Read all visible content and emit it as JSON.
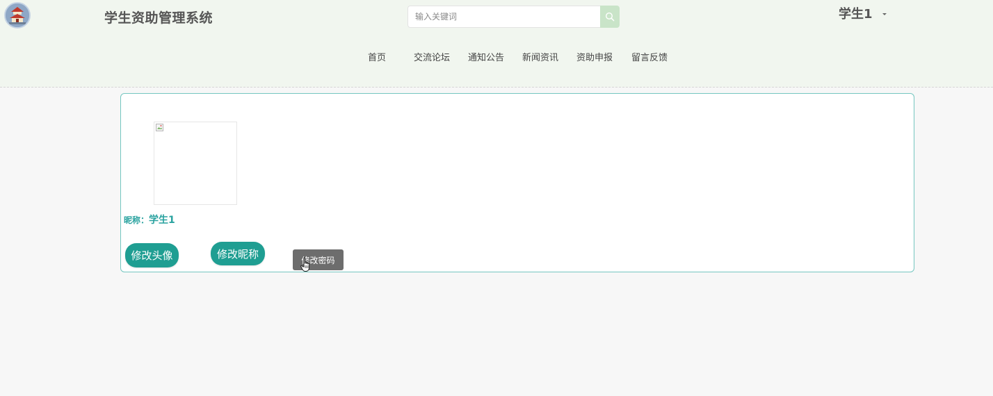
{
  "header": {
    "site_title": "学生资助管理系统",
    "logo_icon": "building-logo-icon",
    "search": {
      "placeholder": "输入关键词",
      "value": "",
      "button_icon": "search-icon"
    },
    "user": {
      "name": "学生1",
      "dropdown_icon": "caret-down-icon"
    }
  },
  "nav": {
    "items": [
      {
        "label": "首页"
      },
      {
        "label": "交流论坛"
      },
      {
        "label": "通知公告"
      },
      {
        "label": "新闻资讯"
      },
      {
        "label": "资助申报"
      },
      {
        "label": "留言反馈"
      }
    ]
  },
  "profile": {
    "avatar_icon": "broken-image-icon",
    "nickname_label": "昵称：",
    "nickname_value": "学生1",
    "buttons": {
      "change_avatar": "修改头像",
      "change_nickname": "修改昵称",
      "change_password": "修改密码"
    }
  },
  "colors": {
    "header_bg": "#f1f6ef",
    "accent_teal": "#1f9e92",
    "card_border": "#74c6c0",
    "search_button": "#c9e4c8",
    "password_button": "#6d6d6d"
  }
}
